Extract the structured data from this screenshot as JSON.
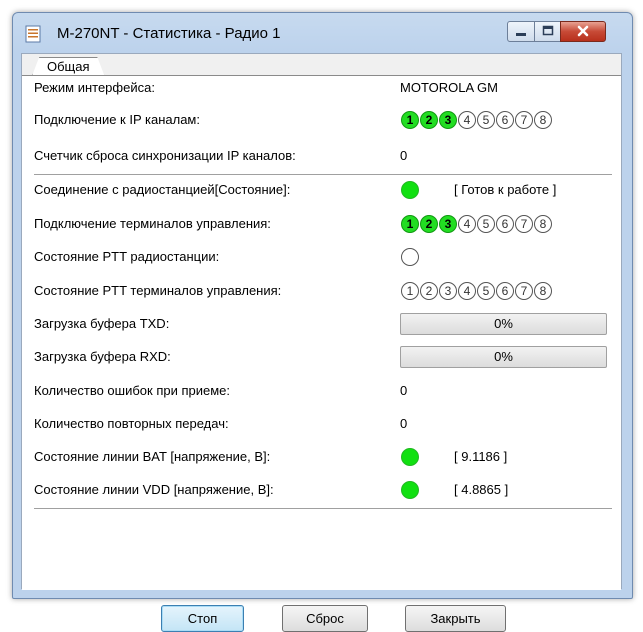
{
  "window": {
    "title": "M-270NT - Статистика - Радио 1"
  },
  "tabs": [
    {
      "label": "Общая"
    }
  ],
  "rows": {
    "interface_mode": {
      "label": "Режим интерфейса:",
      "value": "MOTOROLA GM"
    },
    "ip_channels": {
      "label": "Подключение к IP каналам:",
      "indicators": [
        "1",
        "2",
        "3",
        "4",
        "5",
        "6",
        "7",
        "8"
      ],
      "active": [
        1,
        2,
        3
      ]
    },
    "sync_reset": {
      "label": "Счетчик сброса синхронизации IP каналов:",
      "value": "0"
    },
    "radio_conn": {
      "label": "Соединение с радиостанцией[Состояние]:",
      "status": "[ Готов к работе ]",
      "led": "on"
    },
    "terminals_conn": {
      "label": "Подключение терминалов управления:",
      "indicators": [
        "1",
        "2",
        "3",
        "4",
        "5",
        "6",
        "7",
        "8"
      ],
      "active": [
        1,
        2,
        3
      ]
    },
    "radio_ptt": {
      "label": "Состояние PTT радиостанции:",
      "led": "off"
    },
    "terminals_ptt": {
      "label": "Состояние PTT терминалов управления:",
      "indicators": [
        "1",
        "2",
        "3",
        "4",
        "5",
        "6",
        "7",
        "8"
      ],
      "active": []
    },
    "txd_buffer": {
      "label": "Загрузка буфера TXD:",
      "value": "0%",
      "percent": 0
    },
    "rxd_buffer": {
      "label": "Загрузка буфера RXD:",
      "value": "0%",
      "percent": 0
    },
    "rx_errors": {
      "label": "Количество ошибок при приеме:",
      "value": "0"
    },
    "retransmits": {
      "label": "Количество повторных передач:",
      "value": "0"
    },
    "bat_line": {
      "label": "Состояние линии BAT [напряжение, В]:",
      "value": "[ 9.1186 ]",
      "led": "on"
    },
    "vdd_line": {
      "label": "Состояние линии VDD [напряжение, В]:",
      "value": "[ 4.8865 ]",
      "led": "on"
    }
  },
  "buttons": {
    "stop": "Стоп",
    "reset": "Сброс",
    "close": "Закрыть"
  },
  "colors": {
    "led_on": "#11e011",
    "titlebar": "#bcd2ec",
    "close_button": "#c74a36"
  },
  "icons": {
    "app": "document-app-icon",
    "minimize": "minimize-icon",
    "maximize": "maximize-icon",
    "close": "close-icon"
  }
}
